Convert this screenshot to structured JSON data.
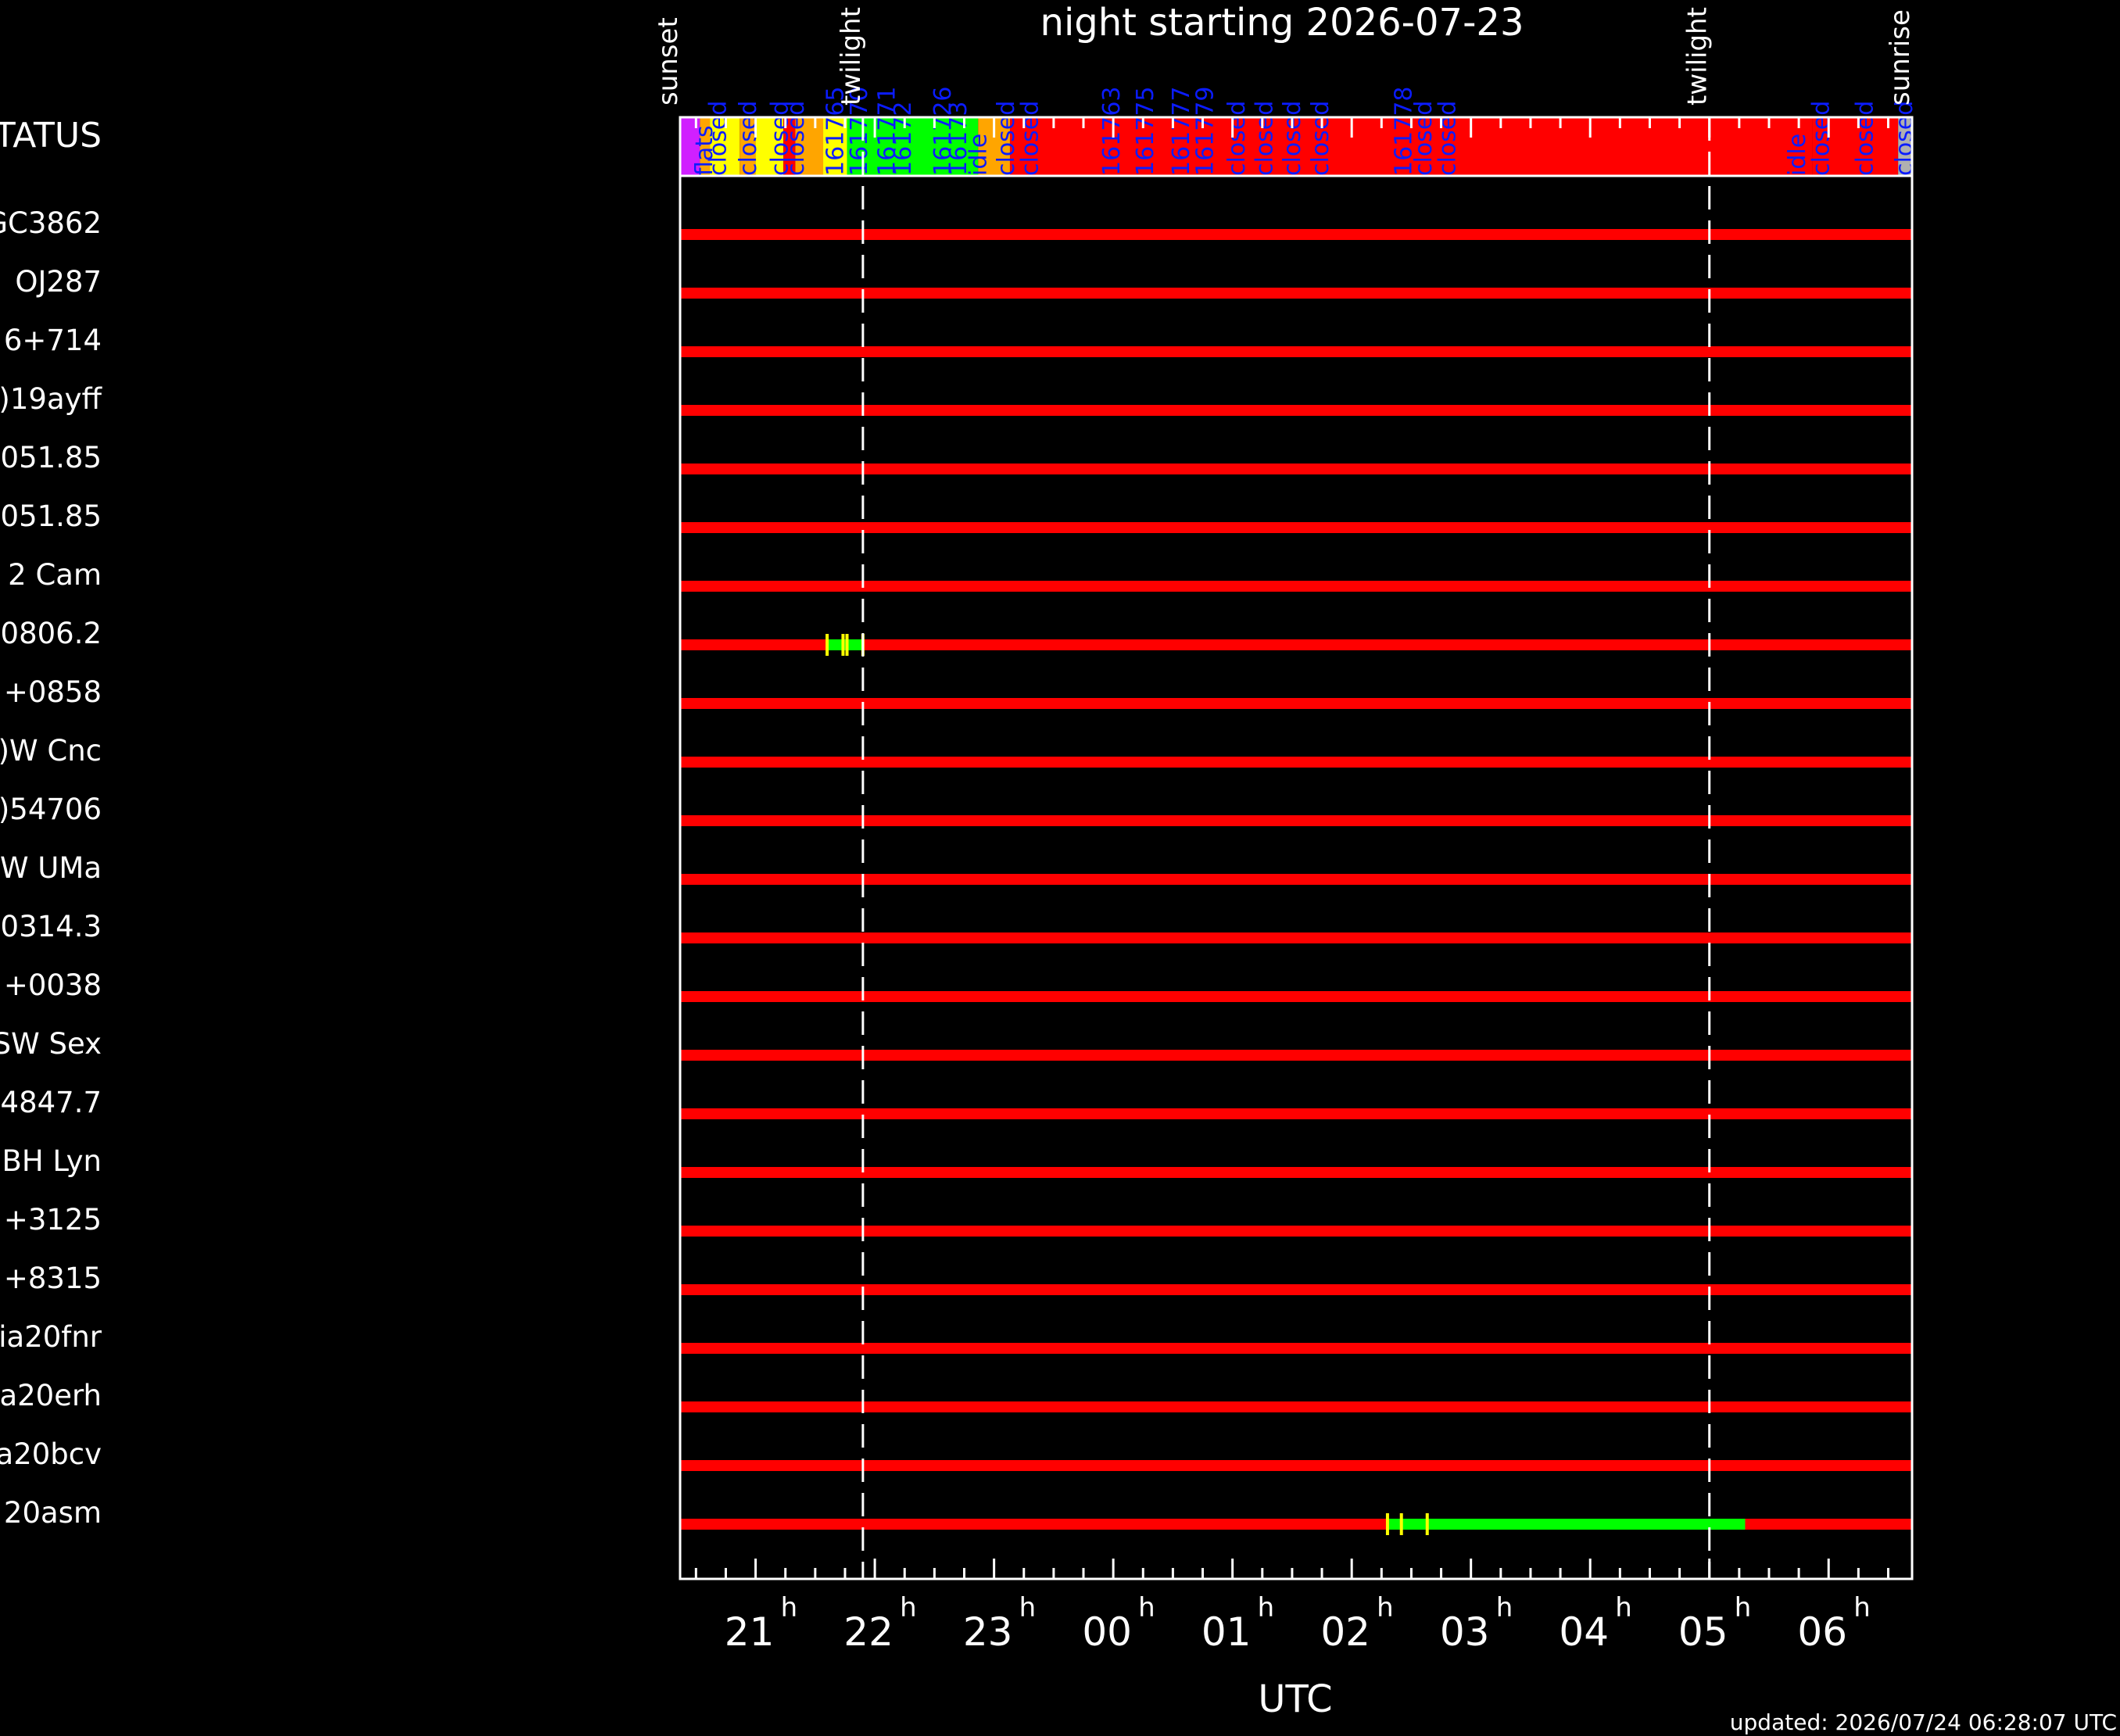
{
  "chart_data": {
    "type": "timeline",
    "title": "night starting 2026-07-23",
    "xlabel": "UTC",
    "x_range": [
      "20:22",
      "06:42"
    ],
    "ticks": [
      {
        "time": "21:00",
        "label": "21",
        "sup": "h"
      },
      {
        "time": "22:00",
        "label": "22",
        "sup": "h"
      },
      {
        "time": "23:00",
        "label": "23",
        "sup": "h"
      },
      {
        "time": "00:00",
        "label": "00",
        "sup": "h"
      },
      {
        "time": "01:00",
        "label": "01",
        "sup": "h"
      },
      {
        "time": "02:00",
        "label": "02",
        "sup": "h"
      },
      {
        "time": "03:00",
        "label": "03",
        "sup": "h"
      },
      {
        "time": "04:00",
        "label": "04",
        "sup": "h"
      },
      {
        "time": "05:00",
        "label": "05",
        "sup": "h"
      },
      {
        "time": "06:00",
        "label": "06",
        "sup": "h"
      }
    ],
    "events": [
      {
        "time": "20:22",
        "label": "sunset",
        "dashed": false
      },
      {
        "time": "21:54",
        "label": "twilight",
        "dashed": true
      },
      {
        "time": "05:00",
        "label": "twilight",
        "dashed": true
      },
      {
        "time": "06:42",
        "label": "sunrise",
        "dashed": false
      }
    ],
    "status_label": "STATUS",
    "status_segments": [
      {
        "start": "20:22",
        "end": "20:37",
        "status": "flats"
      },
      {
        "start": "20:37",
        "end": "20:52",
        "status": "closed"
      },
      {
        "start": "20:52",
        "end": "21:06",
        "status": "closed"
      },
      {
        "start": "21:06",
        "end": "21:14",
        "status": "closed"
      },
      {
        "start": "21:14",
        "end": "21:29",
        "status": "closed"
      },
      {
        "start": "21:29",
        "end": "21:44",
        "status": "closed"
      },
      {
        "start": "21:44",
        "end": "22:04",
        "status": "observing"
      },
      {
        "start": "22:04",
        "end": "22:22",
        "status": "observing"
      },
      {
        "start": "22:22",
        "end": "22:42",
        "status": "observing"
      },
      {
        "start": "22:42",
        "end": "22:52",
        "status": "idle"
      },
      {
        "start": "22:52",
        "end": "23:08",
        "status": "closed"
      },
      {
        "start": "23:08",
        "end": "23:55",
        "status": "closed"
      },
      {
        "start": "23:55",
        "end": "00:47",
        "status": "observing"
      },
      {
        "start": "00:47",
        "end": "01:45",
        "status": "closed"
      },
      {
        "start": "01:45",
        "end": "02:22",
        "status": "closed"
      },
      {
        "start": "02:22",
        "end": "02:48",
        "status": "observing"
      },
      {
        "start": "02:48",
        "end": "05:52",
        "status": "closed"
      },
      {
        "start": "05:52",
        "end": "06:35",
        "status": "idle"
      },
      {
        "start": "06:35",
        "end": "06:42",
        "status": "offline"
      }
    ],
    "status_colors": {
      "flats": "#f2a830",
      "closed": "#ff0000",
      "observing": "#00ff00",
      "idle": "#ff0000",
      "offline": "#b0b0b0",
      "yellow": "#ffff00",
      "orange": "#ffa500",
      "magenta": "#d020ff"
    },
    "status_color_blocks": [
      {
        "start": "20:22",
        "end": "20:32",
        "color": "magenta"
      },
      {
        "start": "20:32",
        "end": "20:37",
        "color": "orange"
      },
      {
        "start": "20:37",
        "end": "20:52",
        "color": "yellow"
      },
      {
        "start": "20:52",
        "end": "21:00",
        "color": "orange"
      },
      {
        "start": "21:00",
        "end": "21:14",
        "color": "yellow"
      },
      {
        "start": "21:14",
        "end": "21:20",
        "color": "closed"
      },
      {
        "start": "21:20",
        "end": "21:34",
        "color": "orange"
      },
      {
        "start": "21:34",
        "end": "21:46",
        "color": "yellow"
      },
      {
        "start": "21:46",
        "end": "22:52",
        "color": "observing"
      },
      {
        "start": "22:52",
        "end": "23:08",
        "color": "orange"
      },
      {
        "start": "23:08",
        "end": "05:52",
        "color": "closed"
      },
      {
        "start": "05:52",
        "end": "06:35",
        "color": "closed"
      },
      {
        "start": "06:35",
        "end": "06:42",
        "color": "offline"
      }
    ],
    "status_text_labels": [
      {
        "time": "20:30",
        "text": "flats"
      },
      {
        "time": "20:37",
        "text": "closed"
      },
      {
        "time": "20:52",
        "text": "closed"
      },
      {
        "time": "21:08",
        "text": "closed"
      },
      {
        "time": "21:16",
        "text": "closed"
      },
      {
        "time": "21:36",
        "text": "161765"
      },
      {
        "time": "21:48",
        "text": "161770"
      },
      {
        "time": "22:02",
        "text": "161771"
      },
      {
        "time": "22:10",
        "text": "16172"
      },
      {
        "time": "22:30",
        "text": "161726"
      },
      {
        "time": "22:38",
        "text": "16173"
      },
      {
        "time": "22:48",
        "text": "idle"
      },
      {
        "time": "23:02",
        "text": "closed"
      },
      {
        "time": "23:14",
        "text": "closed"
      },
      {
        "time": "23:55",
        "text": "161763"
      },
      {
        "time": "00:12",
        "text": "161775"
      },
      {
        "time": "00:30",
        "text": "161777"
      },
      {
        "time": "00:42",
        "text": "161779"
      },
      {
        "time": "00:58",
        "text": "closed"
      },
      {
        "time": "01:12",
        "text": "closed"
      },
      {
        "time": "01:26",
        "text": "closed"
      },
      {
        "time": "01:40",
        "text": "closed"
      },
      {
        "time": "02:22",
        "text": "161778"
      },
      {
        "time": "02:32",
        "text": "closed"
      },
      {
        "time": "02:44",
        "text": "closed"
      },
      {
        "time": "05:40",
        "text": "idle"
      },
      {
        "time": "05:52",
        "text": "closed"
      },
      {
        "time": "06:14",
        "text": "closed"
      },
      {
        "time": "06:34",
        "text": "closed"
      }
    ],
    "targets": [
      {
        "name": "GC3862",
        "observable": [
          {
            "start": "20:22",
            "end": "06:42"
          }
        ],
        "observed": []
      },
      {
        "name": "OJ287",
        "observable": [
          {
            "start": "20:22",
            "end": "06:42"
          }
        ],
        "observed": []
      },
      {
        "name": "6+714",
        "observable": [
          {
            "start": "20:22",
            "end": "06:42"
          }
        ],
        "observed": []
      },
      {
        "name": ")19ayff",
        "observable": [
          {
            "start": "20:22",
            "end": "06:42"
          }
        ],
        "observed": []
      },
      {
        "name": "051.85",
        "observable": [
          {
            "start": "20:22",
            "end": "06:42"
          }
        ],
        "observed": []
      },
      {
        "name": "051.85",
        "observable": [
          {
            "start": "20:22",
            "end": "06:42"
          }
        ],
        "observed": []
      },
      {
        "name": "2 Cam",
        "observable": [
          {
            "start": "20:22",
            "end": "06:42"
          }
        ],
        "observed": []
      },
      {
        "name": "0806.2",
        "observable": [
          {
            "start": "20:22",
            "end": "06:42"
          }
        ],
        "observed": [
          {
            "start": "21:36",
            "end": "21:54"
          }
        ],
        "marks": [
          "21:36",
          "21:44",
          "21:46",
          "21:54"
        ]
      },
      {
        "name": "+0858",
        "observable": [
          {
            "start": "20:22",
            "end": "06:42"
          }
        ],
        "observed": []
      },
      {
        "name": ")W Cnc",
        "observable": [
          {
            "start": "20:22",
            "end": "06:42"
          }
        ],
        "observed": []
      },
      {
        "name": ")54706",
        "observable": [
          {
            "start": "20:22",
            "end": "06:42"
          }
        ],
        "observed": []
      },
      {
        "name": ")W UMa",
        "observable": [
          {
            "start": "20:22",
            "end": "06:42"
          }
        ],
        "observed": []
      },
      {
        "name": "0314.3",
        "observable": [
          {
            "start": "20:22",
            "end": "06:42"
          }
        ],
        "observed": []
      },
      {
        "name": "+0038",
        "observable": [
          {
            "start": "20:22",
            "end": "06:42"
          }
        ],
        "observed": []
      },
      {
        "name": "SW Sex",
        "observable": [
          {
            "start": "20:22",
            "end": "06:42"
          }
        ],
        "observed": []
      },
      {
        "name": "4847.7",
        "observable": [
          {
            "start": "20:22",
            "end": "06:42"
          }
        ],
        "observed": []
      },
      {
        "name": "BH Lyn",
        "observable": [
          {
            "start": "20:22",
            "end": "06:42"
          }
        ],
        "observed": []
      },
      {
        "name": "+3125",
        "observable": [
          {
            "start": "20:22",
            "end": "06:42"
          }
        ],
        "observed": []
      },
      {
        "name": "+8315",
        "observable": [
          {
            "start": "20:22",
            "end": "06:42"
          }
        ],
        "observed": []
      },
      {
        "name": "ia20fnr",
        "observable": [
          {
            "start": "20:22",
            "end": "06:42"
          }
        ],
        "observed": []
      },
      {
        "name": "a20erh",
        "observable": [
          {
            "start": "20:22",
            "end": "06:42"
          }
        ],
        "observed": []
      },
      {
        "name": "a20bcv",
        "observable": [
          {
            "start": "20:22",
            "end": "06:42"
          }
        ],
        "observed": []
      },
      {
        "name": "20asm",
        "observable": [
          {
            "start": "20:22",
            "end": "06:42"
          }
        ],
        "observed": [
          {
            "start": "02:18",
            "end": "05:18"
          }
        ],
        "marks": [
          "02:18",
          "02:25",
          "02:38"
        ]
      }
    ],
    "row_colors": {
      "observable": "#ff0000",
      "observed": "#00ff00",
      "mark": "#ffff00"
    },
    "updated": "updated: 2026/07/24 06:28:07 UTC"
  }
}
